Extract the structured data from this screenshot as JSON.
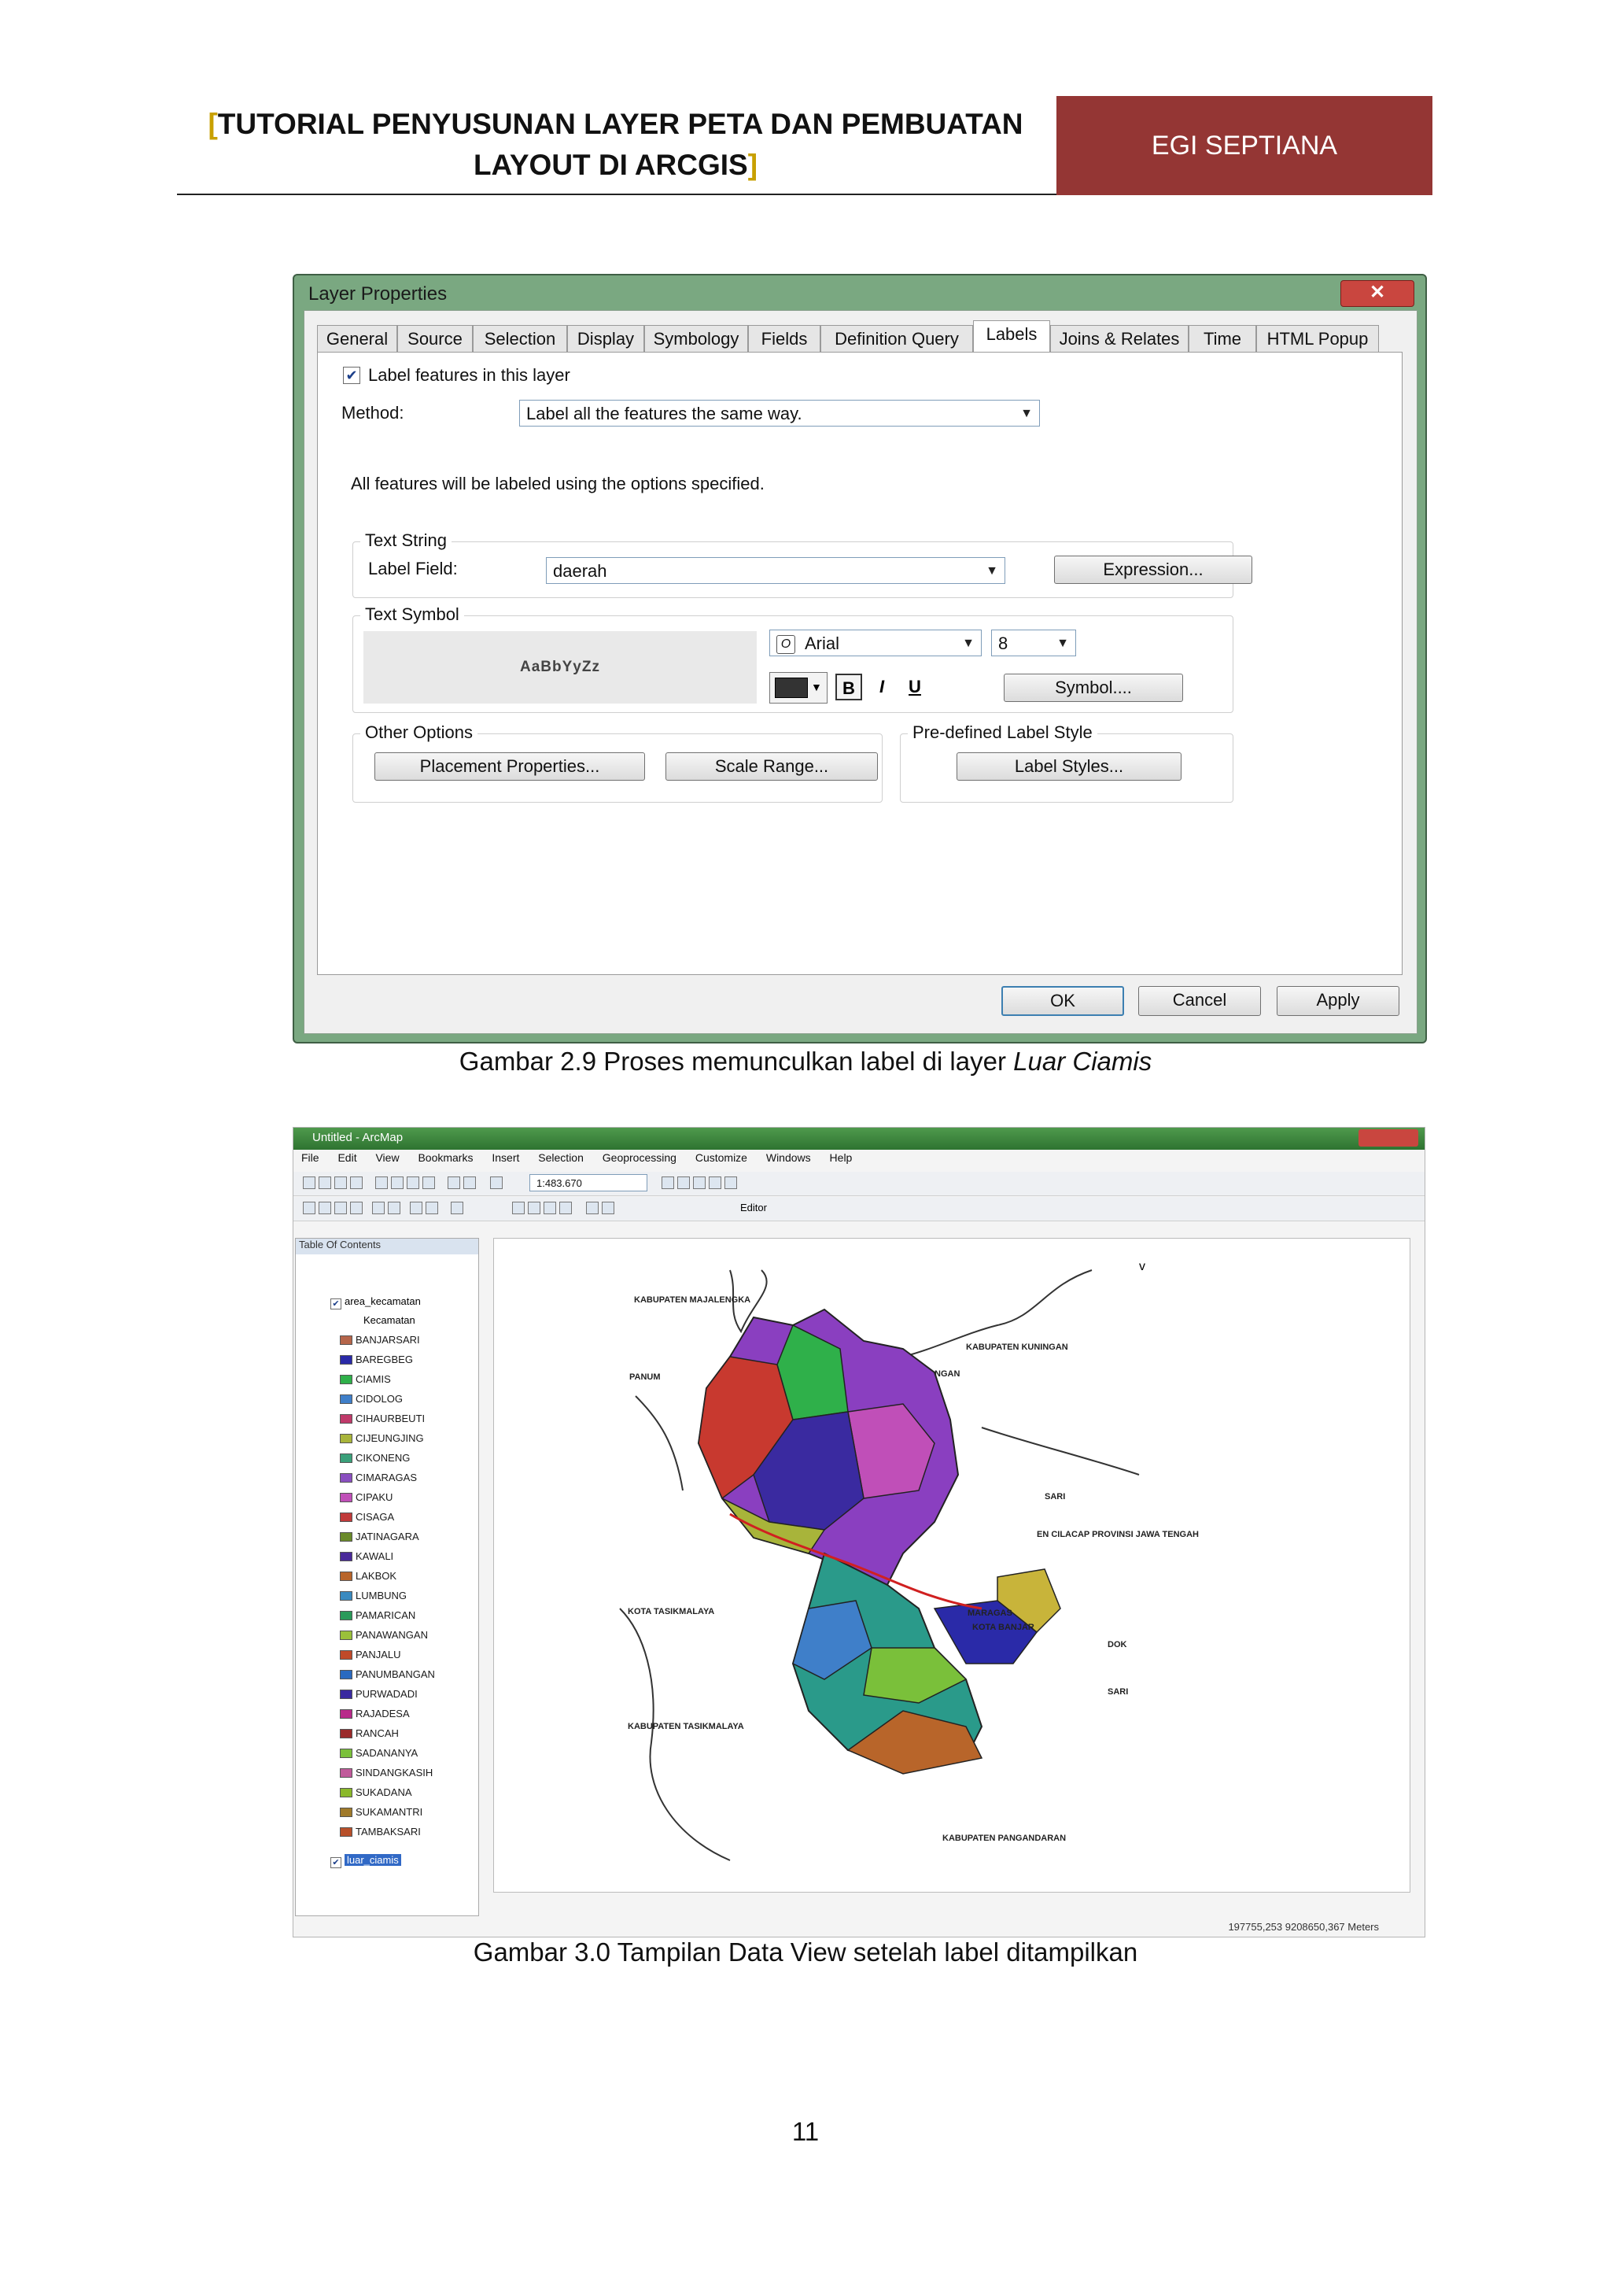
{
  "header": {
    "title_line1": "TUTORIAL PENYUSUNAN LAYER PETA DAN PEMBUATAN",
    "title_line2": "LAYOUT DI ARCGIS",
    "bracket_open": "[",
    "bracket_close": "]",
    "author": "EGI SEPTIANA",
    "author_bg": "#943634"
  },
  "dialog": {
    "title": "Layer Properties",
    "close": "✕",
    "tabs": [
      "General",
      "Source",
      "Selection",
      "Display",
      "Symbology",
      "Fields",
      "Definition Query",
      "Labels",
      "Joins & Relates",
      "Time",
      "HTML Popup"
    ],
    "active_tab": "Labels",
    "label_features": "Label features in this layer",
    "method_label": "Method:",
    "method_value": "Label all the features the same way.",
    "info": "All features will be labeled using the options specified.",
    "text_string_group": "Text String",
    "label_field_label": "Label Field:",
    "label_field_value": "daerah",
    "expression_button": "Expression...",
    "text_symbol_group": "Text Symbol",
    "preview_text": "AaBbYyZz",
    "font_name": "Arial",
    "font_size": "8",
    "bold": "B",
    "italic": "I",
    "underline": "U",
    "symbol_button": "Symbol....",
    "other_options_group": "Other Options",
    "placement_button": "Placement Properties...",
    "scale_range_button": "Scale Range...",
    "predefined_group": "Pre-defined Label Style",
    "label_styles_button": "Label Styles...",
    "ok": "OK",
    "cancel": "Cancel",
    "apply": "Apply"
  },
  "caption1": {
    "text": "Gambar 2.9 Proses memunculkan label di layer",
    "italic": "Luar Ciamis"
  },
  "arcmap": {
    "title": "Untitled - ArcMap",
    "menu": [
      "File",
      "Edit",
      "View",
      "Bookmarks",
      "Insert",
      "Selection",
      "Geoprocessing",
      "Customize",
      "Windows",
      "Help"
    ],
    "scale": "1:483.670",
    "editor": "Editor",
    "toc_title": "Table Of Contents",
    "layer_name": "area_kecamatan",
    "field_name": "Kecamatan",
    "legend": [
      {
        "name": "BANJARSARI",
        "color": "#b5654a"
      },
      {
        "name": "BAREGBEG",
        "color": "#2a2aa8"
      },
      {
        "name": "CIAMIS",
        "color": "#2fb04a"
      },
      {
        "name": "CIDOLOG",
        "color": "#3f7fc9"
      },
      {
        "name": "CIHAURBEUTI",
        "color": "#c03a6a"
      },
      {
        "name": "CIJEUNGJING",
        "color": "#a8b43a"
      },
      {
        "name": "CIKONENG",
        "color": "#3aa07a"
      },
      {
        "name": "CIMARAGAS",
        "color": "#8a4fc0"
      },
      {
        "name": "CIPAKU",
        "color": "#c04fb8"
      },
      {
        "name": "CISAGA",
        "color": "#c03a3a"
      },
      {
        "name": "JATINAGARA",
        "color": "#6a8a2a"
      },
      {
        "name": "KAWALI",
        "color": "#4a2a9a"
      },
      {
        "name": "LAKBOK",
        "color": "#b8652a"
      },
      {
        "name": "LUMBUNG",
        "color": "#3a8ac0"
      },
      {
        "name": "PAMARICAN",
        "color": "#2a9a5a"
      },
      {
        "name": "PANAWANGAN",
        "color": "#9ac03a"
      },
      {
        "name": "PANJALU",
        "color": "#c04a2a"
      },
      {
        "name": "PANUMBANGAN",
        "color": "#2a6ac0"
      },
      {
        "name": "PURWADADI",
        "color": "#3a2aa0"
      },
      {
        "name": "RAJADESA",
        "color": "#b82a8a"
      },
      {
        "name": "RANCAH",
        "color": "#9a2a2a"
      },
      {
        "name": "SADANANYA",
        "color": "#7ac03a"
      },
      {
        "name": "SINDANGKASIH",
        "color": "#c05a9a"
      },
      {
        "name": "SUKADANA",
        "color": "#8ab82a"
      },
      {
        "name": "SUKAMANTRI",
        "color": "#a07a2a"
      },
      {
        "name": "TAMBAKSARI",
        "color": "#b8502a"
      }
    ],
    "second_layer": "luar_ciamis",
    "map_labels": [
      "KABUPATEN MAJALENGKA",
      "KABUPATEN KUNINGAN",
      "PANUM",
      "NGAN",
      "SARI",
      "EN CILACAP PROVINSI JAWA TENGAH",
      "KOTA TASIKMALAYA",
      "MARAGAS",
      "KOTA BANJAR",
      "DOK",
      "KABUPATEN TASIKMALAYA",
      "SARI",
      "KABUPATEN PANGANDARAN"
    ],
    "coords": "197755,253  9208650,367 Meters"
  },
  "caption2": {
    "text": "Gambar 3.0 Tampilan Data View setelah label ditampilkan"
  },
  "page_number": "11"
}
